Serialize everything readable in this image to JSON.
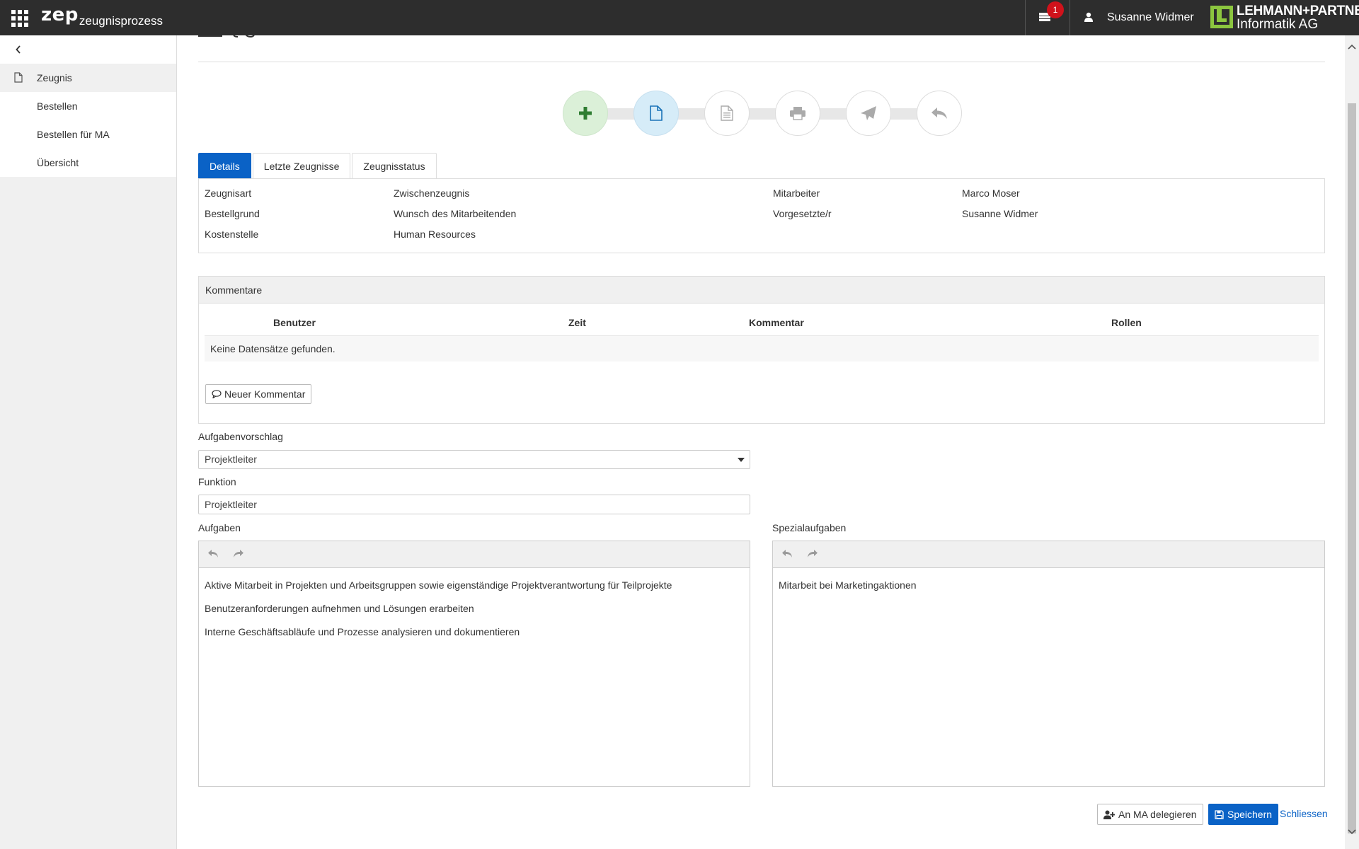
{
  "topbar": {
    "app_name": "zep",
    "app_sub": "zeugnisprozess",
    "notifications_count": "1",
    "user_name": "Susanne Widmer",
    "logo_line1": "LEHMANN+PARTNER",
    "logo_line2": "Informatik AG",
    "bg_color": "#2d2d2d",
    "badge_color": "#d0121b"
  },
  "sidebar": {
    "header": "Zeugnis",
    "items": [
      {
        "label": "Bestellen"
      },
      {
        "label": "Bestellen für MA"
      },
      {
        "label": "Übersicht"
      }
    ]
  },
  "stepper": {
    "steps": [
      {
        "icon": "plus-icon",
        "state": "done"
      },
      {
        "icon": "document-icon",
        "state": "active"
      },
      {
        "icon": "document-text-icon",
        "state": "inactive"
      },
      {
        "icon": "print-icon",
        "state": "inactive"
      },
      {
        "icon": "send-icon",
        "state": "inactive"
      },
      {
        "icon": "reply-icon",
        "state": "inactive"
      }
    ]
  },
  "tabs": [
    {
      "label": "Details",
      "active": true
    },
    {
      "label": "Letzte Zeugnisse",
      "active": false
    },
    {
      "label": "Zeugnisstatus",
      "active": false
    }
  ],
  "details": {
    "zeugnisart_label": "Zeugnisart",
    "zeugnisart_value": "Zwischenzeugnis",
    "bestellgrund_label": "Bestellgrund",
    "bestellgrund_value": "Wunsch des Mitarbeitenden",
    "kostenstelle_label": "Kostenstelle",
    "kostenstelle_value": "Human Resources",
    "mitarbeiter_label": "Mitarbeiter",
    "mitarbeiter_value": "Marco Moser",
    "vorgesetzte_label": "Vorgesetzte/r",
    "vorgesetzte_value": "Susanne Widmer"
  },
  "comments": {
    "title": "Kommentare",
    "columns": [
      "Benutzer",
      "Zeit",
      "Kommentar",
      "Rollen"
    ],
    "empty_text": "Keine Datensätze gefunden.",
    "new_button": "Neuer Kommentar"
  },
  "form": {
    "aufgabenvorschlag_label": "Aufgabenvorschlag",
    "aufgabenvorschlag_value": "Projektleiter",
    "funktion_label": "Funktion",
    "funktion_value": "Projektleiter",
    "aufgaben_label": "Aufgaben",
    "aufgaben": [
      "Aktive Mitarbeit in Projekten und Arbeitsgruppen sowie eigenständige Projektverantwortung für Teilprojekte",
      "Benutzeranforderungen aufnehmen und Lösungen erarbeiten",
      "Interne Geschäftsabläufe und Prozesse analysieren und dokumentieren"
    ],
    "spezial_label": "Spezialaufgaben",
    "spezial": [
      "Mitarbeit bei Marketingaktionen"
    ]
  },
  "footer": {
    "delegate_button": "An MA delegieren",
    "save_button": "Speichern",
    "close_link": "Schliessen",
    "accent_color": "#0a62c6"
  }
}
